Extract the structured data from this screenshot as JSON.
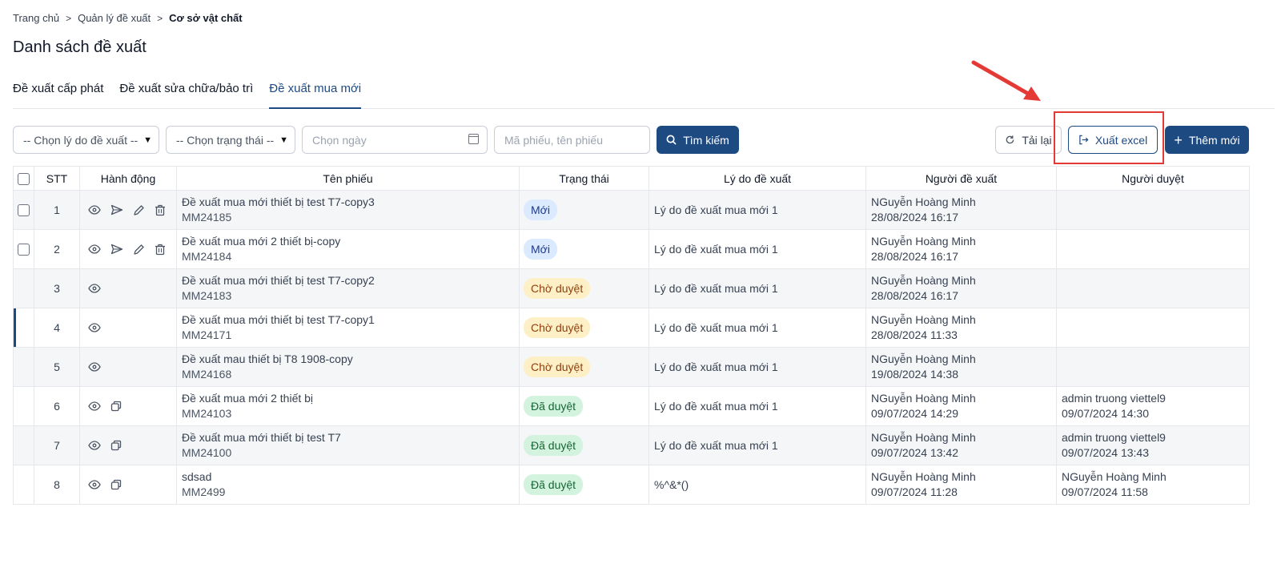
{
  "breadcrumb": {
    "home": "Trang chủ",
    "level2": "Quản lý đề xuất",
    "current": "Cơ sở vật chất"
  },
  "page_title": "Danh sách đề xuất",
  "tabs": [
    {
      "label": "Đề xuất cấp phát"
    },
    {
      "label": "Đề xuất sửa chữa/bảo trì"
    },
    {
      "label": "Đề xuất mua mới"
    }
  ],
  "toolbar": {
    "reason_select": "-- Chọn lý do đề xuất --",
    "status_select": "-- Chọn trạng thái --",
    "date_placeholder": "Chọn ngày",
    "keyword_placeholder": "Mã phiếu, tên phiếu",
    "search_label": "Tìm kiếm",
    "reload_label": "Tải lại",
    "export_label": "Xuất excel",
    "add_label": "Thêm mới"
  },
  "table": {
    "headers": {
      "stt": "STT",
      "action": "Hành động",
      "name": "Tên phiếu",
      "status": "Trạng thái",
      "reason": "Lý do đề xuất",
      "proposer": "Người đề xuất",
      "approver": "Người duyệt"
    },
    "rows": [
      {
        "stt": "1",
        "name": "Đề xuất mua mới thiết bị test T7-copy3",
        "code": "MM24185",
        "status": "Mới",
        "reason": "Lý do đề xuất mua mới 1",
        "proposer": "NGuyễn Hoàng Minh",
        "proposed_at": "28/08/2024 16:17",
        "approver": "",
        "approved_at": ""
      },
      {
        "stt": "2",
        "name": "Đề xuất mua mới 2 thiết bị-copy",
        "code": "MM24184",
        "status": "Mới",
        "reason": "Lý do đề xuất mua mới 1",
        "proposer": "NGuyễn Hoàng Minh",
        "proposed_at": "28/08/2024 16:17",
        "approver": "",
        "approved_at": ""
      },
      {
        "stt": "3",
        "name": "Đề xuất mua mới thiết bị test T7-copy2",
        "code": "MM24183",
        "status": "Chờ duyệt",
        "reason": "Lý do đề xuất mua mới 1",
        "proposer": "NGuyễn Hoàng Minh",
        "proposed_at": "28/08/2024 16:17",
        "approver": "",
        "approved_at": ""
      },
      {
        "stt": "4",
        "name": "Đề xuất mua mới thiết bị test T7-copy1",
        "code": "MM24171",
        "status": "Chờ duyệt",
        "reason": "Lý do đề xuất mua mới 1",
        "proposer": "NGuyễn Hoàng Minh",
        "proposed_at": "28/08/2024 11:33",
        "approver": "",
        "approved_at": ""
      },
      {
        "stt": "5",
        "name": "Đề xuất mau thiết bị T8 1908-copy",
        "code": "MM24168",
        "status": "Chờ duyệt",
        "reason": "Lý do đề xuất mua mới 1",
        "proposer": "NGuyễn Hoàng Minh",
        "proposed_at": "19/08/2024 14:38",
        "approver": "",
        "approved_at": ""
      },
      {
        "stt": "6",
        "name": "Đề xuất mua mới 2 thiết bị",
        "code": "MM24103",
        "status": "Đã duyệt",
        "reason": "Lý do đề xuất mua mới 1",
        "proposer": "NGuyễn Hoàng Minh",
        "proposed_at": "09/07/2024 14:29",
        "approver": "admin truong viettel9",
        "approved_at": "09/07/2024 14:30"
      },
      {
        "stt": "7",
        "name": "Đề xuất mua mới thiết bị test T7",
        "code": "MM24100",
        "status": "Đã duyệt",
        "reason": "Lý do đề xuất mua mới 1",
        "proposer": "NGuyễn Hoàng Minh",
        "proposed_at": "09/07/2024 13:42",
        "approver": "admin truong viettel9",
        "approved_at": "09/07/2024 13:43"
      },
      {
        "stt": "8",
        "name": "sdsad",
        "code": "MM2499",
        "status": "Đã duyệt",
        "reason": "%^&*()",
        "proposer": "NGuyễn Hoàng Minh",
        "proposed_at": "09/07/2024 11:28",
        "approver": "NGuyễn Hoàng Minh",
        "approved_at": "09/07/2024 11:58"
      }
    ]
  },
  "colors": {
    "primary": "#1e4a82",
    "highlight": "#e53935",
    "badge_new": "#dbeafe",
    "badge_wait": "#fdefc6",
    "badge_done": "#d4f3df"
  },
  "icons": {
    "view": "eye-icon",
    "send": "send-icon",
    "edit": "pencil-icon",
    "delete": "trash-icon",
    "copy": "copy-icon",
    "search": "search-icon",
    "reload": "refresh-icon",
    "export": "export-icon",
    "add": "plus-icon",
    "date": "calendar-icon"
  }
}
